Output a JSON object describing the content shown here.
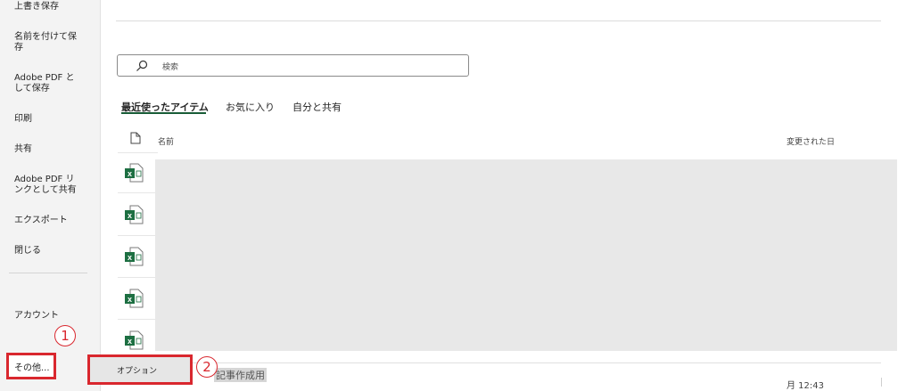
{
  "sidebar": {
    "items": [
      {
        "label": "上書き保存"
      },
      {
        "label": "名前を付けて保存"
      },
      {
        "label": "Adobe PDF として保存"
      },
      {
        "label": "印刷"
      },
      {
        "label": "共有"
      },
      {
        "label": "Adobe PDF リンクとして共有"
      },
      {
        "label": "エクスポート"
      },
      {
        "label": "閉じる"
      },
      {
        "label": "アカウント"
      }
    ],
    "more_label": "その他..."
  },
  "search": {
    "placeholder": "検索",
    "icon": "search-icon"
  },
  "tabs": [
    {
      "label": "最近使ったアイテム",
      "active": true
    },
    {
      "label": "お気に入り",
      "active": false
    },
    {
      "label": "自分と共有",
      "active": false
    }
  ],
  "columns": {
    "name": "名前",
    "modified": "変更された日"
  },
  "files": [
    {
      "icon": "excel-file-icon"
    },
    {
      "icon": "excel-file-icon"
    },
    {
      "icon": "excel-file-icon"
    },
    {
      "icon": "excel-file-icon"
    },
    {
      "icon": "excel-file-icon"
    }
  ],
  "popup": {
    "option_label": "オプション"
  },
  "partial_file_name": "記事作成用",
  "last_date": "月 12:43",
  "annotations": {
    "step1": "1",
    "step2": "2"
  },
  "colors": {
    "highlight": "#d9272e",
    "accent": "#185c37",
    "excel_green": "#1d6f42"
  }
}
